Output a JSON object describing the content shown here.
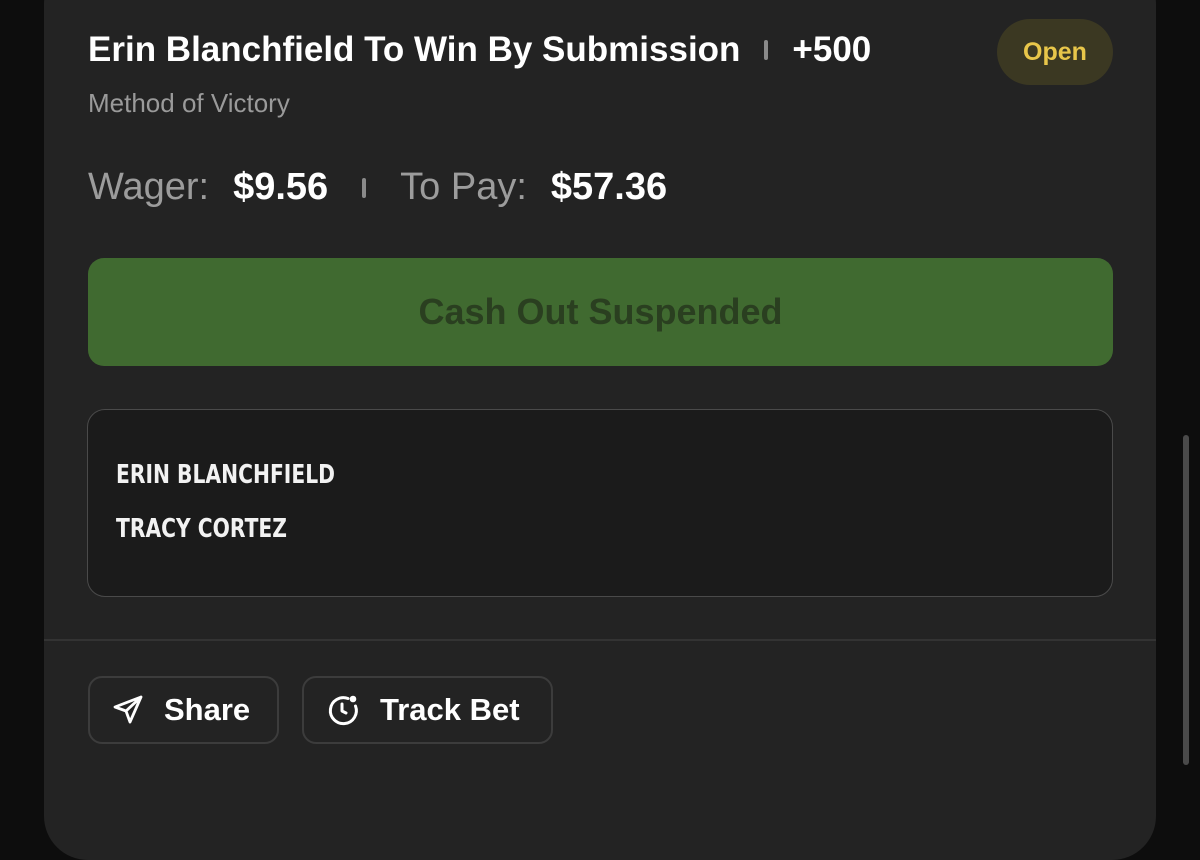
{
  "bet": {
    "selection": "Erin Blanchfield To Win By Submission",
    "odds": "+500",
    "status": "Open",
    "market": "Method of Victory"
  },
  "amounts": {
    "wager_label": "Wager:",
    "wager_value": "$9.56",
    "to_pay_label": "To Pay:",
    "to_pay_value": "$57.36"
  },
  "cashout": {
    "label": "Cash Out Suspended"
  },
  "fighters": [
    "ERIN BLANCHFIELD",
    "TRACY CORTEZ"
  ],
  "actions": {
    "share_label": "Share",
    "track_label": "Track Bet"
  },
  "icons": {
    "share": "send-icon",
    "track": "track-clock-icon"
  },
  "colors": {
    "status_text": "#e8c64a",
    "cashout_bg": "#406a30",
    "card_bg": "#232323"
  }
}
